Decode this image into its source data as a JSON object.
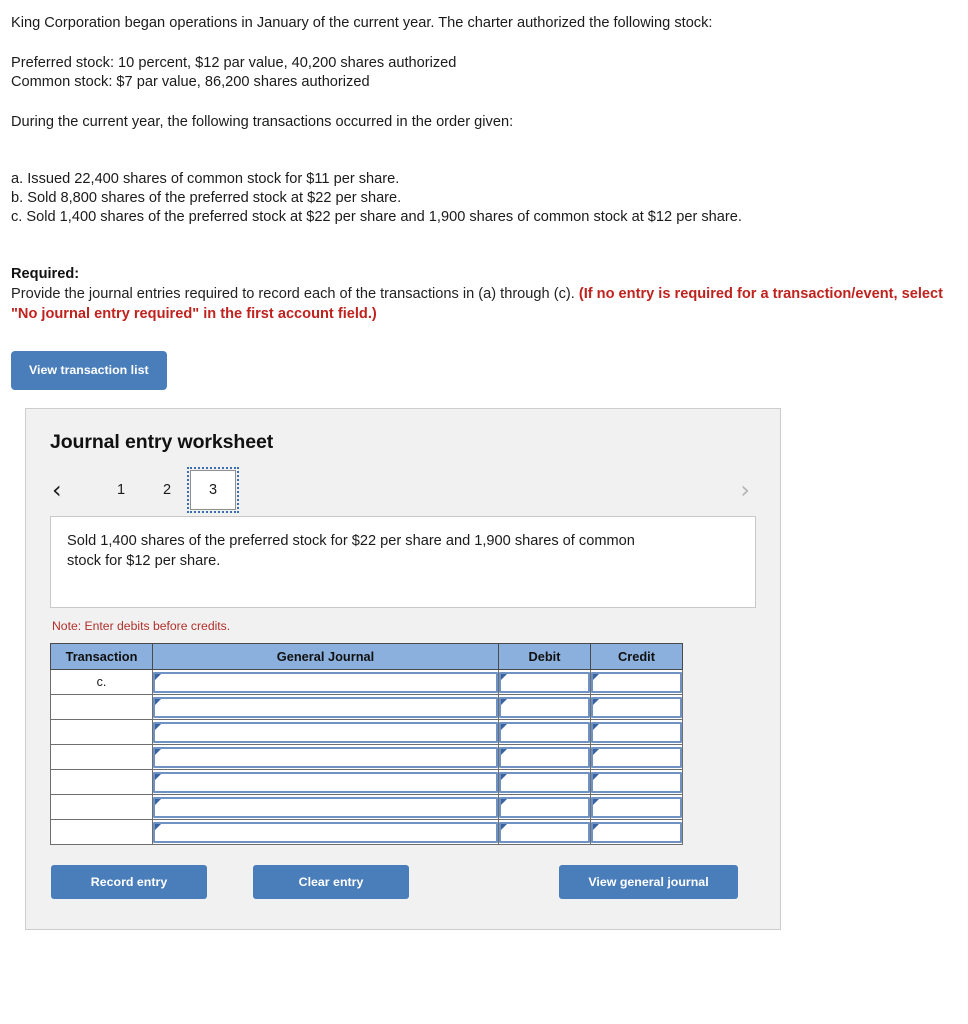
{
  "problem": {
    "intro": "King Corporation began operations in January of the current year. The charter authorized the following stock:",
    "stock_lines": [
      "Preferred stock: 10 percent,  $12 par value, 40,200 shares authorized",
      "Common stock: $7 par value, 86,200 shares authorized"
    ],
    "transactions_intro": "During the current year, the following transactions occurred in the order given:",
    "transactions": [
      "a. Issued 22,400 shares of common stock for $11 per share.",
      "b. Sold 8,800 shares of the preferred stock at $22 per share.",
      "c. Sold 1,400 shares of the preferred stock at $22 per share and 1,900 shares of common stock at $12 per share."
    ]
  },
  "required": {
    "heading": "Required:",
    "body_plain": "Provide the journal entries required to record each of the transactions in (a) through (c). ",
    "body_red": "(If no entry is required for a transaction/event, select \"No journal entry required\" in the first account field.)"
  },
  "toolbar": {
    "view_transaction_list_label": "View transaction list"
  },
  "worksheet": {
    "title": "Journal entry worksheet",
    "pager": {
      "prev_icon": "chevron-left-icon",
      "next_icon": "chevron-right-icon",
      "prev_glyph": "‹",
      "next_glyph": "›",
      "tabs": [
        "1",
        "2",
        "3"
      ],
      "active_tab": "3"
    },
    "description": "Sold 1,400 shares of the preferred stock for $22 per share and 1,900 shares of common stock for $12 per share.",
    "note": "Note: Enter debits before credits.",
    "table": {
      "headers": [
        "Transaction",
        "General Journal",
        "Debit",
        "Credit"
      ],
      "rows": [
        {
          "transaction": "c.",
          "general_journal": "",
          "debit": "",
          "credit": ""
        },
        {
          "transaction": "",
          "general_journal": "",
          "debit": "",
          "credit": ""
        },
        {
          "transaction": "",
          "general_journal": "",
          "debit": "",
          "credit": ""
        },
        {
          "transaction": "",
          "general_journal": "",
          "debit": "",
          "credit": ""
        },
        {
          "transaction": "",
          "general_journal": "",
          "debit": "",
          "credit": ""
        },
        {
          "transaction": "",
          "general_journal": "",
          "debit": "",
          "credit": ""
        },
        {
          "transaction": "",
          "general_journal": "",
          "debit": "",
          "credit": ""
        }
      ]
    },
    "footer": {
      "record_entry_label": "Record entry",
      "clear_entry_label": "Clear entry",
      "view_general_journal_label": "View general journal"
    }
  },
  "colors": {
    "button_blue": "#4a7ebb",
    "table_header_blue": "#8cb0dd",
    "input_border_blue": "#6e92c4",
    "note_red": "#b0302c",
    "required_red": "#c0221e",
    "panel_bg": "#f1f1f1"
  }
}
